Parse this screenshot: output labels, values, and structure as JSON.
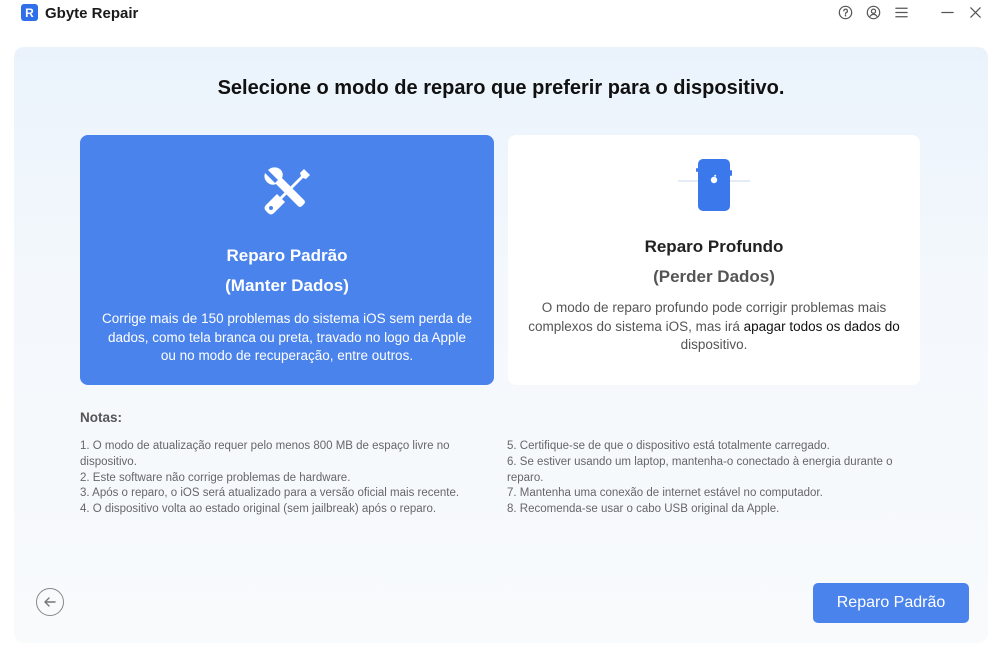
{
  "app": {
    "title": "Gbyte Repair",
    "logo_letter": "R"
  },
  "icons": {
    "help": "help-circle-icon",
    "account": "account-circle-icon",
    "menu": "menu-icon",
    "minimize": "minimize-icon",
    "close": "close-icon",
    "tools": "wrench-screwdriver-icon",
    "device": "phone-icon",
    "back": "arrow-left-icon"
  },
  "colors": {
    "accent": "#4a83ec",
    "brand": "#2f6fea"
  },
  "main": {
    "heading": "Selecione o modo de reparo que preferir para o dispositivo.",
    "standard_card": {
      "title": "Reparo Padrão",
      "subtitle": "(Manter Dados)",
      "description": "Corrige mais de 150 problemas do sistema iOS sem perda de dados, como tela branca ou preta, travado no logo da Apple ou no modo de recuperação, entre outros."
    },
    "deep_card": {
      "title": "Reparo Profundo",
      "subtitle": "(Perder Dados)",
      "description_part1": "O modo de reparo profundo pode corrigir problemas mais complexos do sistema iOS, mas irá ",
      "description_emphasis": "apagar todos os dados do",
      "description_part2": "dispositivo."
    },
    "notes": {
      "title": "Notas:",
      "left": [
        "1. O modo de atualização requer pelo menos 800 MB de espaço livre no dispositivo.",
        "2. Este software não corrige problemas de hardware.",
        "3. Após o reparo, o iOS será atualizado para a versão oficial mais recente.",
        "4. O dispositivo volta ao estado original (sem jailbreak) após o reparo."
      ],
      "right": [
        "5. Certifique-se de que o dispositivo está totalmente carregado.",
        "6. Se estiver usando um laptop, mantenha-o conectado à energia durante o reparo.",
        "7. Mantenha uma conexão de internet estável no computador.",
        "8. Recomenda-se usar o cabo USB original da Apple."
      ]
    },
    "primary_button": "Reparo Padrão"
  }
}
